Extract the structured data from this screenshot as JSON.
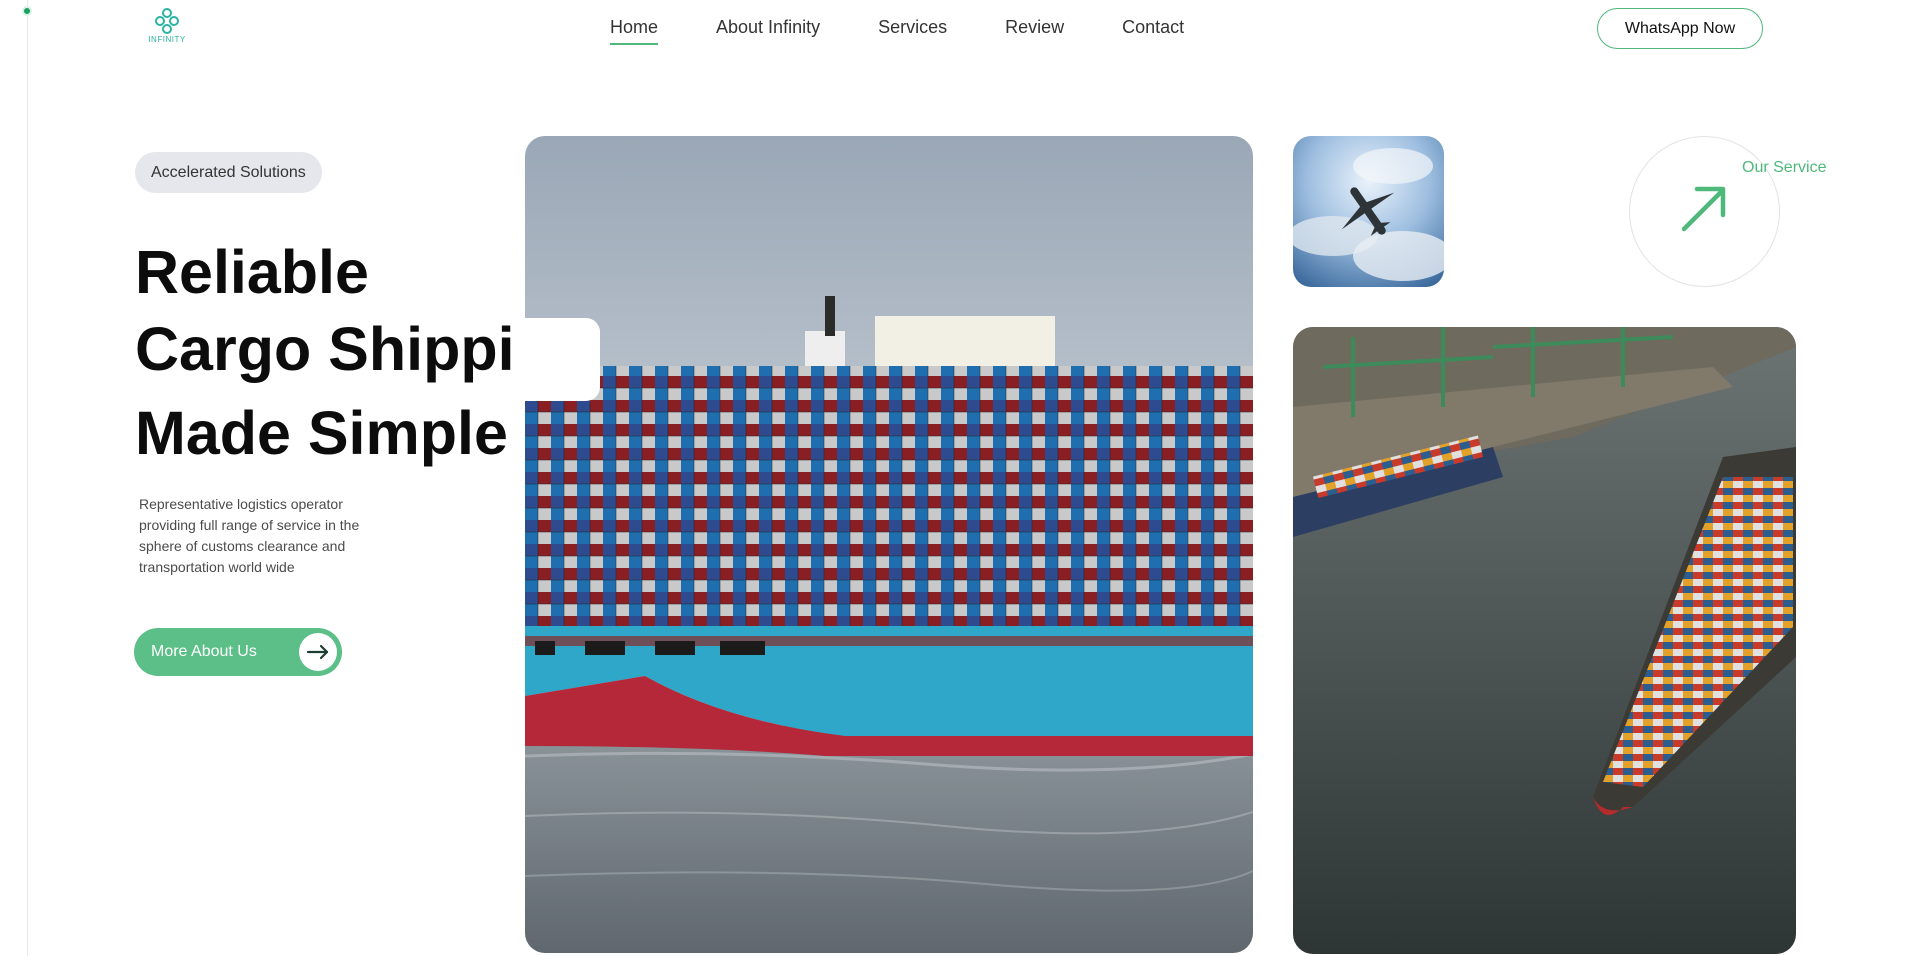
{
  "brand": {
    "name": "INFINITY",
    "logo_icon": "infinity-knot-logo",
    "accent": "#4fb97c"
  },
  "nav": {
    "items": [
      {
        "label": "Home",
        "active": true
      },
      {
        "label": "About Infinity",
        "active": false
      },
      {
        "label": "Services",
        "active": false
      },
      {
        "label": "Review",
        "active": false
      },
      {
        "label": "Contact",
        "active": false
      }
    ],
    "cta": "WhatsApp Now"
  },
  "hero": {
    "badge": "Accelerated Solutions",
    "title": [
      "Reliable",
      "Cargo Shipping",
      "Made Simple"
    ],
    "description": "Representative logistics operator providing full range of service in the sphere of customs clearance and transportation world wide",
    "button": {
      "label": "More About Us",
      "icon": "arrow-right-icon"
    }
  },
  "gallery": {
    "main_image": "container-ship-photo",
    "plane_image": "airplane-sky-photo",
    "port_image": "port-aerial-photo"
  },
  "service_link": {
    "label": "Our Service",
    "icon": "arrow-up-right-icon"
  },
  "colors": {
    "accent": "#4fb97c",
    "button_bg": "#5cbf87",
    "badge_bg": "#e6e7ec",
    "logo": "#2bb3a3"
  }
}
